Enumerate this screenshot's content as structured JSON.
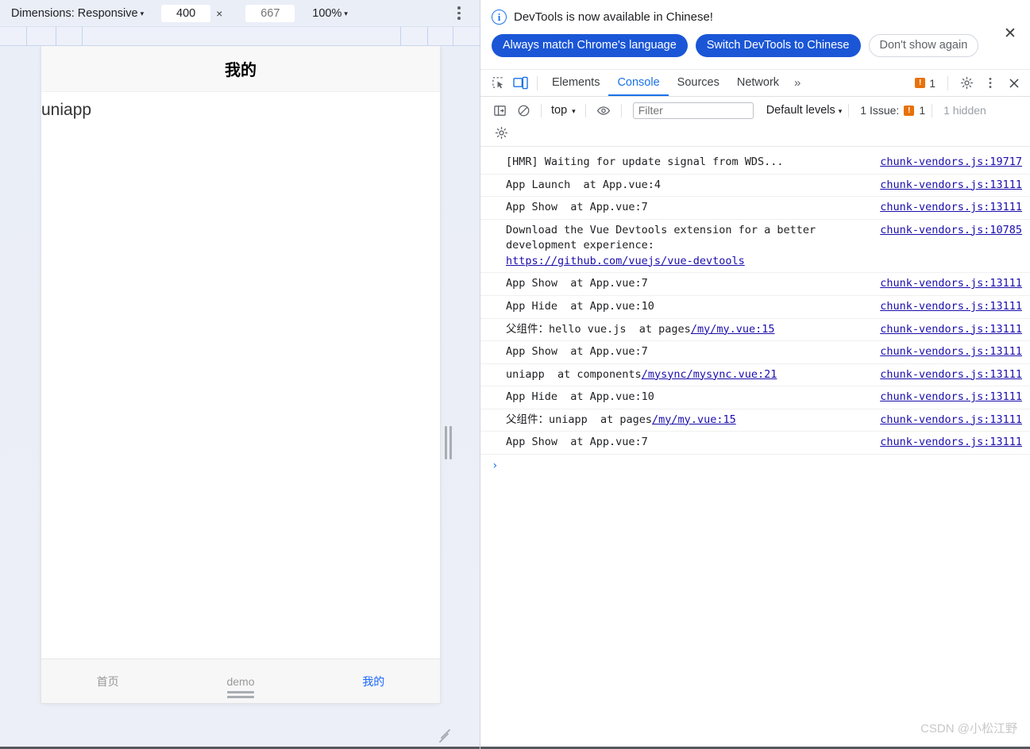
{
  "device_pane": {
    "toolbar": {
      "dimensions_label": "Dimensions: Responsive",
      "width_value": "400",
      "height_value": "667",
      "height_placeholder": "667",
      "times": "×",
      "zoom_label": "100%",
      "caret": "▾",
      "more_options": "more-options"
    },
    "viewport": {
      "navbar_title": "我的",
      "body_text": "uniapp",
      "tabs": [
        {
          "label": "首页",
          "active": false
        },
        {
          "label": "demo",
          "active": false
        },
        {
          "label": "我的",
          "active": true
        }
      ],
      "active_color": "#1a66ff",
      "inactive_color": "#999999"
    }
  },
  "devtools": {
    "infobar": {
      "message": "DevTools is now available in Chinese!",
      "info_glyph": "i",
      "buttons": [
        {
          "label": "Always match Chrome's language",
          "style": "primary"
        },
        {
          "label": "Switch DevTools to Chinese",
          "style": "primary"
        },
        {
          "label": "Don't show again",
          "style": "ghost"
        }
      ],
      "close_glyph": "✕",
      "primary_color": "#1a56d6"
    },
    "tabbar": {
      "tabs": [
        {
          "label": "Elements",
          "active": false
        },
        {
          "label": "Console",
          "active": true
        },
        {
          "label": "Sources",
          "active": false
        },
        {
          "label": "Network",
          "active": false
        }
      ],
      "more_tabs_glyph": "»",
      "error_count": "1",
      "error_glyph": "!",
      "settings": "gear-icon",
      "kebab": "kebab-icon",
      "close_glyph": "✕",
      "accent_color": "#1a73e8",
      "error_color": "#e8710a"
    },
    "console_toolbar": {
      "sidebar_toggle": "console-sidebar-icon",
      "clear_glyph": "⊘",
      "context_label": "top",
      "caret": "▾",
      "eye_label": "live-expression-icon",
      "filter_placeholder": "Filter",
      "filter_value": "",
      "levels_label": "Default levels",
      "issues_label": "1 Issue:",
      "issues_count": "1",
      "hidden_label": "1 hidden",
      "settings_glyph": "gear-icon"
    },
    "logs": [
      {
        "message": "[HMR] Waiting for update signal from WDS...",
        "source": "chunk-vendors.js:19717"
      },
      {
        "message": "App Launch  at App.vue:4",
        "source": "chunk-vendors.js:13111"
      },
      {
        "message": "App Show  at App.vue:7",
        "source": "chunk-vendors.js:13111"
      },
      {
        "message": "Download the Vue Devtools extension for a better\ndevelopment experience:\n",
        "link": "https://github.com/vuejs/vue-devtools",
        "source": "chunk-vendors.js:10785"
      },
      {
        "message": "App Show  at App.vue:7",
        "source": "chunk-vendors.js:13111"
      },
      {
        "message": "App Hide  at App.vue:10",
        "source": "chunk-vendors.js:13111"
      },
      {
        "message": "父组件：hello vue.js  at pages",
        "link": "/my/my.vue:15",
        "source": "chunk-vendors.js:13111"
      },
      {
        "message": "App Show  at App.vue:7",
        "source": "chunk-vendors.js:13111"
      },
      {
        "message": "uniapp  at components",
        "link": "/mysync/mysync.vue:21",
        "source": "chunk-vendors.js:13111"
      },
      {
        "message": "App Hide  at App.vue:10",
        "source": "chunk-vendors.js:13111"
      },
      {
        "message": "父组件：uniapp  at pages",
        "link": "/my/my.vue:15",
        "source": "chunk-vendors.js:13111"
      },
      {
        "message": "App Show  at App.vue:7",
        "source": "chunk-vendors.js:13111"
      }
    ],
    "prompt_glyph": "›"
  },
  "watermark": "CSDN @小松江野"
}
